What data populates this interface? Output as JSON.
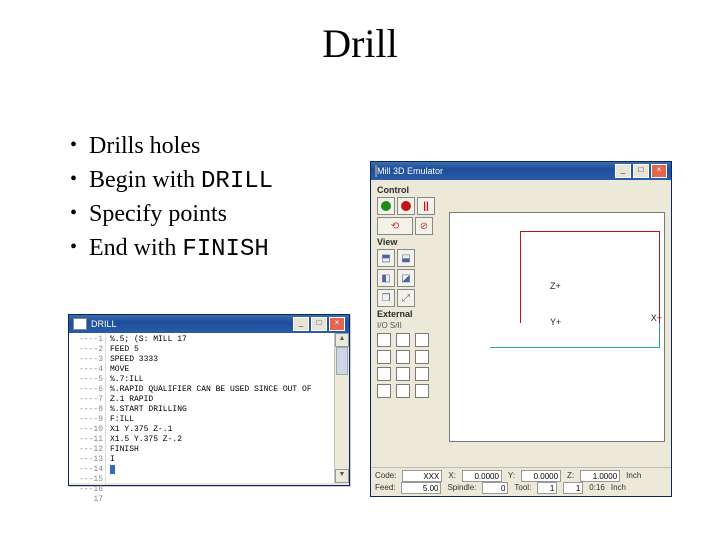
{
  "title": "Drill",
  "bullets": [
    {
      "text": "Drills holes"
    },
    {
      "prefix": "Begin with ",
      "mono": "DRILL"
    },
    {
      "text": "Specify points"
    },
    {
      "prefix": "End with ",
      "mono": "FINISH"
    }
  ],
  "editor": {
    "title": "DRILL",
    "lineNums": [
      "----1",
      "----2",
      "----3",
      "----4",
      "----5",
      "----6",
      "----7",
      "----8",
      "----9",
      "---10",
      "---11",
      "---12",
      "---13",
      "---14",
      "---15",
      "---16",
      "   17"
    ],
    "lines": [
      "%.5; (S: MILL 17",
      "FEED 5",
      "SPEED 3333",
      "MOVE",
      "%.7:ILL",
      "%.RAPID QUALIFIER CAN BE USED SINCE OUT OF",
      "Z.1 RAPID",
      "%.START DRILLING",
      "F:ILL",
      "X1 Y.375 Z-.1",
      "X1.5 Y.375 Z-.2",
      "FINISH",
      "I",
      "",
      "",
      "",
      ""
    ],
    "highlight_index": 13
  },
  "mill": {
    "title": "Mill 3D Emulator",
    "sect_control": "Control",
    "sect_view": "View",
    "sect_external": "External",
    "external_val": "I/O  S/II",
    "axis": {
      "z": "Z+",
      "y": "Y+",
      "x": "X+"
    },
    "status": {
      "row1": {
        "code_l": "Code:",
        "code": "XXX",
        "x_l": "X:",
        "x": "0.0000",
        "y_l": "Y:",
        "y": "0.0000",
        "z_l": "Z:",
        "z": "1.0000",
        "unit": "Inch"
      },
      "row2": {
        "feed_l": "Feed:",
        "feed": "5.00",
        "spindle_l": "Spindle:",
        "spindle": "0",
        "tool_l": "Tool:",
        "tool1": "1",
        "tool2": "1",
        "time": "0:16",
        "tunit": "Inch"
      }
    }
  }
}
